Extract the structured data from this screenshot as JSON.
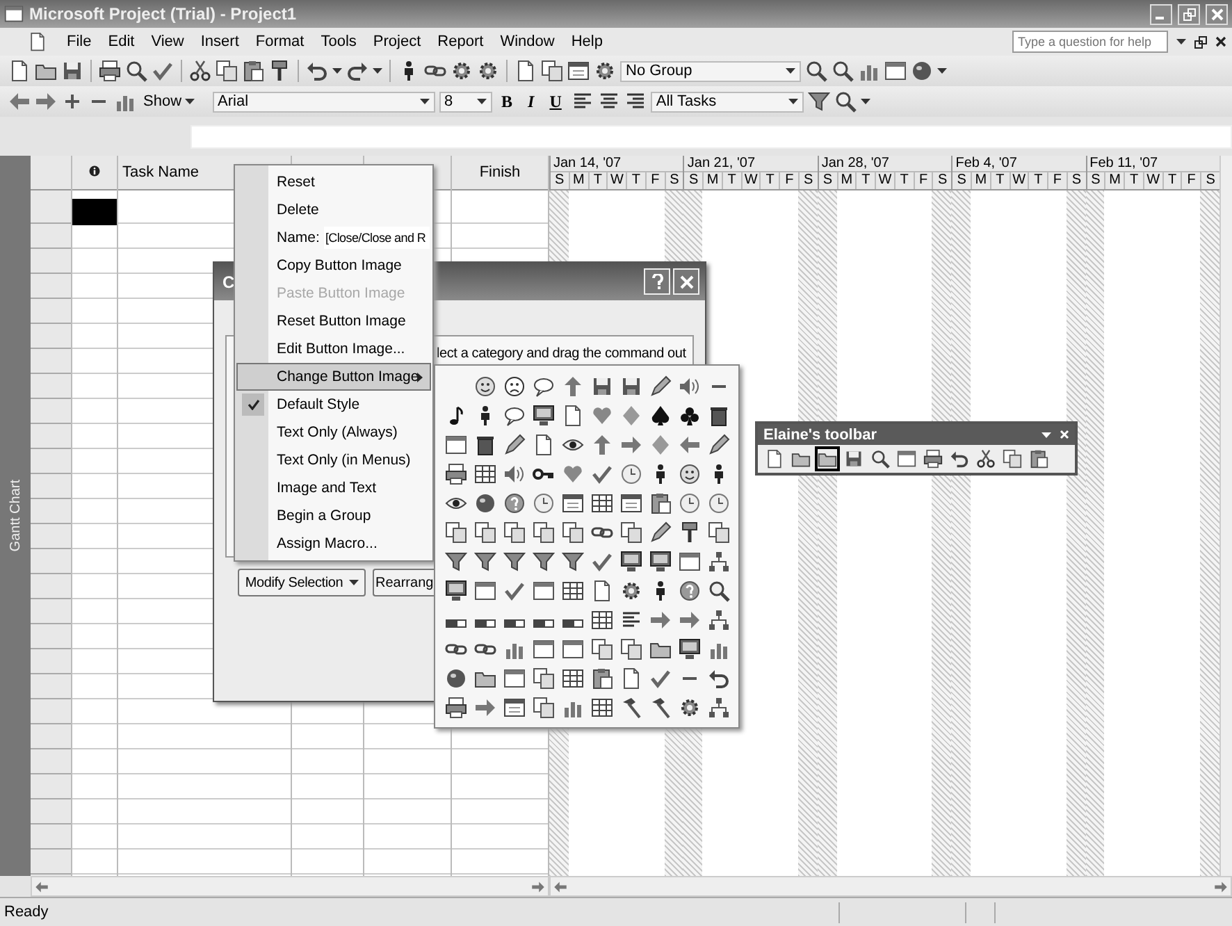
{
  "window": {
    "title": "Microsoft Project (Trial) - Project1"
  },
  "menu_bar": {
    "items": [
      "File",
      "Edit",
      "View",
      "Insert",
      "Format",
      "Tools",
      "Project",
      "Report",
      "Window",
      "Help"
    ],
    "help_box": {
      "placeholder": "Type a question for help"
    }
  },
  "standard_toolbar": {
    "group_combo": "No Group"
  },
  "formatting_toolbar": {
    "show_button": "Show",
    "font_combo": "Arial",
    "size_combo": "8",
    "style_buttons": [
      "B",
      "I",
      "U"
    ],
    "filter_combo": "All Tasks"
  },
  "view_bar": {
    "label": "Gantt Chart"
  },
  "table": {
    "columns": [
      {
        "kind": "indicator"
      },
      {
        "kind": "text",
        "label": "Task Name"
      },
      {
        "kind": "covered"
      },
      {
        "kind": "covered"
      },
      {
        "kind": "text",
        "label": "Finish"
      }
    ],
    "cursor_cell": {
      "selected": true
    }
  },
  "timescale": {
    "weeks": [
      {
        "label": "Jan 14, '07",
        "days": [
          "S",
          "M",
          "T",
          "W",
          "T",
          "F",
          "S"
        ]
      },
      {
        "label": "Jan 21, '07",
        "days": [
          "S",
          "M",
          "T",
          "W",
          "T",
          "F",
          "S"
        ]
      },
      {
        "label": "Jan 28, '07",
        "days": [
          "S",
          "M",
          "T",
          "W",
          "T",
          "F",
          "S"
        ]
      },
      {
        "label": "Feb 4, '07",
        "days": [
          "S",
          "M",
          "T",
          "W",
          "T",
          "F",
          "S"
        ]
      },
      {
        "label": "Feb 11, '07",
        "days": [
          "S",
          "M",
          "T",
          "W",
          "T",
          "F",
          "S"
        ]
      }
    ]
  },
  "customize_dialog": {
    "title": "C",
    "instruction": "lect a category and drag the command out",
    "buttons": [
      {
        "kind": "dropdown",
        "label": "Modify Selection"
      },
      {
        "kind": "plain",
        "label": "Rearrang"
      }
    ]
  },
  "context_menu": {
    "items": [
      {
        "kind": "command",
        "label": "Reset",
        "disabled": false,
        "selected": false,
        "checked": false
      },
      {
        "kind": "command",
        "label": "Delete",
        "disabled": false,
        "selected": false,
        "checked": false
      },
      {
        "kind": "name_field",
        "label": "Name:",
        "value": "[Close/Close and R",
        "disabled": false,
        "selected": false,
        "checked": false
      },
      {
        "kind": "command",
        "label": "Copy Button Image",
        "disabled": false,
        "selected": false,
        "checked": false
      },
      {
        "kind": "command",
        "label": "Paste Button Image",
        "disabled": true,
        "selected": false,
        "checked": false
      },
      {
        "kind": "command",
        "label": "Reset Button Image",
        "disabled": false,
        "selected": false,
        "checked": false
      },
      {
        "kind": "command",
        "label": "Edit Button Image...",
        "disabled": false,
        "selected": false,
        "checked": false
      },
      {
        "kind": "submenu",
        "label": "Change Button Image",
        "disabled": false,
        "selected": true,
        "checked": false
      },
      {
        "kind": "command",
        "label": "Default Style",
        "disabled": false,
        "selected": false,
        "checked": true
      },
      {
        "kind": "command",
        "label": "Text Only (Always)",
        "disabled": false,
        "selected": false,
        "checked": false
      },
      {
        "kind": "command",
        "label": "Text Only (in Menus)",
        "disabled": false,
        "selected": false,
        "checked": false
      },
      {
        "kind": "command",
        "label": "Image and Text",
        "disabled": false,
        "selected": false,
        "checked": false
      },
      {
        "kind": "command",
        "label": "Begin a Group",
        "disabled": false,
        "selected": false,
        "checked": false
      },
      {
        "kind": "command",
        "label": "Assign Macro...",
        "disabled": false,
        "selected": false,
        "checked": false
      }
    ]
  },
  "floating_toolbar": {
    "title": "Elaine's toolbar",
    "buttons": [
      {
        "selected": false
      },
      {
        "selected": false
      },
      {
        "selected": true
      },
      {
        "selected": false
      },
      {
        "selected": false
      },
      {
        "selected": false
      },
      {
        "selected": false
      },
      {
        "selected": false
      },
      {
        "selected": false
      },
      {
        "selected": false
      },
      {
        "selected": false
      }
    ]
  },
  "status_bar": {
    "text": "Ready"
  }
}
